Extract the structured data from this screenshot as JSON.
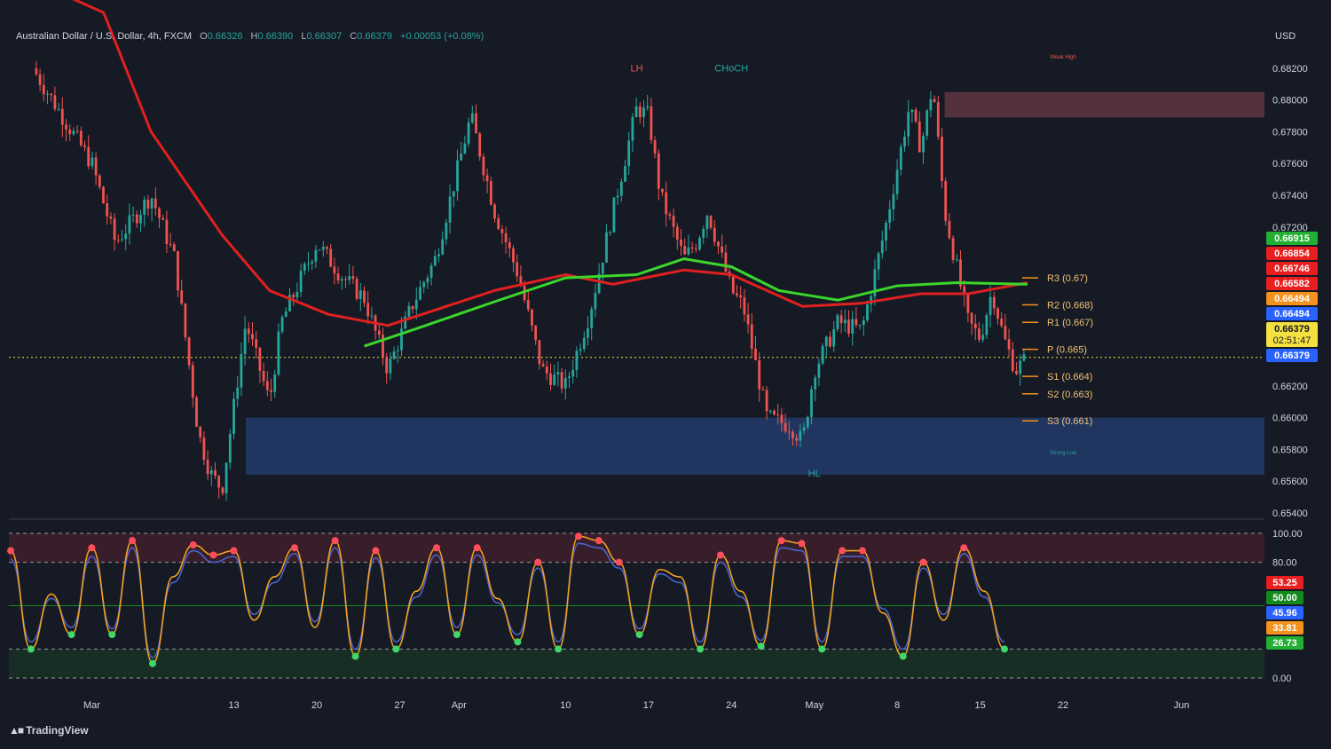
{
  "header": {
    "symbol": "Australian Dollar / U.S. Dollar, 4h, FXCM",
    "open_label": "O",
    "open": "0.66326",
    "high_label": "H",
    "high": "0.66390",
    "low_label": "L",
    "low": "0.66307",
    "close_label": "C",
    "close": "0.66379",
    "change": "+0.00053 (+0.08%)"
  },
  "currency": "USD",
  "brand": "TradingView",
  "colors": {
    "background": "#161a25",
    "bull": "#26a69a",
    "bear": "#ef5350",
    "ma_red": "#e0201f",
    "ma_green": "#3bd62a",
    "demand_zone": "#2a4d8f",
    "supply_zone": "#6b3a45",
    "stoch_k": "#4a62c9",
    "stoch_d": "#f0a01e"
  },
  "chart_data": [
    {
      "type": "candlestick",
      "title": "Australian Dollar / U.S. Dollar, 4h, FXCM",
      "ylim": [
        0.654,
        0.6835
      ],
      "y_ticks": [
        "0.68200",
        "0.68000",
        "0.67800",
        "0.67600",
        "0.67400",
        "0.67200",
        "0.66200",
        "0.66000",
        "0.65800",
        "0.65600",
        "0.65400"
      ],
      "x_ticks": [
        "Mar",
        "13",
        "20",
        "27",
        "Apr",
        "10",
        "17",
        "24",
        "May",
        "8",
        "15",
        "22",
        "Jun"
      ],
      "price_path": [
        {
          "date": "Feb 24",
          "price": 0.682
        },
        {
          "date": "Mar 1",
          "price": 0.676
        },
        {
          "date": "Mar 3",
          "price": 0.671
        },
        {
          "date": "Mar 6",
          "price": 0.674
        },
        {
          "date": "Mar 8",
          "price": 0.67
        },
        {
          "date": "Mar 10",
          "price": 0.659
        },
        {
          "date": "Mar 11",
          "price": 0.6565
        },
        {
          "date": "Mar 12",
          "price": 0.6555
        },
        {
          "date": "Mar 14",
          "price": 0.666
        },
        {
          "date": "Mar 16",
          "price": 0.661
        },
        {
          "date": "Mar 17",
          "price": 0.666
        },
        {
          "date": "Mar 20",
          "price": 0.671
        },
        {
          "date": "Mar 22",
          "price": 0.669
        },
        {
          "date": "Mar 24",
          "price": 0.6675
        },
        {
          "date": "Mar 26",
          "price": 0.663
        },
        {
          "date": "Mar 28",
          "price": 0.667
        },
        {
          "date": "Mar 30",
          "price": 0.67
        },
        {
          "date": "Apr 2",
          "price": 0.679
        },
        {
          "date": "Apr 4",
          "price": 0.673
        },
        {
          "date": "Apr 6",
          "price": 0.669
        },
        {
          "date": "Apr 8",
          "price": 0.663
        },
        {
          "date": "Apr 10",
          "price": 0.662
        },
        {
          "date": "Apr 12",
          "price": 0.6665
        },
        {
          "date": "Apr 14",
          "price": 0.673
        },
        {
          "date": "Apr 16",
          "price": 0.6795
        },
        {
          "date": "Apr 17",
          "price": 0.679
        },
        {
          "date": "Apr 18",
          "price": 0.674
        },
        {
          "date": "Apr 20",
          "price": 0.67
        },
        {
          "date": "Apr 21",
          "price": 0.671
        },
        {
          "date": "Apr 22",
          "price": 0.673
        },
        {
          "date": "Apr 24",
          "price": 0.668
        },
        {
          "date": "Apr 25",
          "price": 0.667
        },
        {
          "date": "Apr 27",
          "price": 0.66
        },
        {
          "date": "Apr 29",
          "price": 0.6595
        },
        {
          "date": "Apr 30",
          "price": 0.6585
        },
        {
          "date": "May 1",
          "price": 0.663
        },
        {
          "date": "May 3",
          "price": 0.666
        },
        {
          "date": "May 5",
          "price": 0.6655
        },
        {
          "date": "May 7",
          "price": 0.672
        },
        {
          "date": "May 9",
          "price": 0.6795
        },
        {
          "date": "May 10",
          "price": 0.677
        },
        {
          "date": "May 11",
          "price": 0.681
        },
        {
          "date": "May 12",
          "price": 0.673
        },
        {
          "date": "May 14",
          "price": 0.666
        },
        {
          "date": "May 15",
          "price": 0.665
        },
        {
          "date": "May 16",
          "price": 0.668
        },
        {
          "date": "May 17",
          "price": 0.665
        },
        {
          "date": "May 18",
          "price": 0.663
        },
        {
          "date": "May 19",
          "price": 0.66379
        }
      ],
      "ma_slow": [
        {
          "date": "Feb 24",
          "price": 0.6875
        },
        {
          "date": "Mar 2",
          "price": 0.6855
        },
        {
          "date": "Mar 6",
          "price": 0.678
        },
        {
          "date": "Mar 12",
          "price": 0.6715
        },
        {
          "date": "Mar 16",
          "price": 0.668
        },
        {
          "date": "Mar 21",
          "price": 0.6665
        },
        {
          "date": "Mar 26",
          "price": 0.6658
        },
        {
          "date": "Apr 4",
          "price": 0.668
        },
        {
          "date": "Apr 10",
          "price": 0.669
        },
        {
          "date": "Apr 14",
          "price": 0.6684
        },
        {
          "date": "Apr 20",
          "price": 0.6693
        },
        {
          "date": "Apr 24",
          "price": 0.669
        },
        {
          "date": "Apr 30",
          "price": 0.667
        },
        {
          "date": "May 5",
          "price": 0.6672
        },
        {
          "date": "May 10",
          "price": 0.6678
        },
        {
          "date": "May 14",
          "price": 0.6678
        },
        {
          "date": "May 19",
          "price": 0.6685
        }
      ],
      "ma_green": [
        {
          "date": "Mar 24",
          "price": 0.6645
        },
        {
          "date": "Mar 28",
          "price": 0.6655
        },
        {
          "date": "Apr 4",
          "price": 0.6673
        },
        {
          "date": "Apr 10",
          "price": 0.6688
        },
        {
          "date": "Apr 16",
          "price": 0.669
        },
        {
          "date": "Apr 20",
          "price": 0.67
        },
        {
          "date": "Apr 24",
          "price": 0.6695
        },
        {
          "date": "Apr 28",
          "price": 0.668
        },
        {
          "date": "May 3",
          "price": 0.6674
        },
        {
          "date": "May 8",
          "price": 0.6683
        },
        {
          "date": "May 13",
          "price": 0.6685
        },
        {
          "date": "May 19",
          "price": 0.6684
        }
      ],
      "levels": [
        {
          "label": "R3 (0.67)",
          "price": 0.6688
        },
        {
          "label": "R2 (0.668)",
          "price": 0.6671
        },
        {
          "label": "R1 (0.667)",
          "price": 0.666
        },
        {
          "label": "P (0.665)",
          "price": 0.6643
        },
        {
          "label": "S1 (0.664)",
          "price": 0.6626
        },
        {
          "label": "S2 (0.663)",
          "price": 0.6615
        },
        {
          "label": "S3 (0.661)",
          "price": 0.6598
        }
      ],
      "zones": [
        {
          "type": "supply",
          "from": "May 12",
          "to": "Jun 8",
          "top": 0.6805,
          "bottom": 0.6789
        },
        {
          "type": "demand",
          "from": "Mar 14",
          "to": "Jun 8",
          "top": 0.66,
          "bottom": 0.6564
        }
      ],
      "annotations": [
        {
          "text": "LH",
          "date": "Apr 16",
          "price": 0.6818
        },
        {
          "text": "CHoCH",
          "date": "Apr 24",
          "price": 0.6818
        },
        {
          "text": "HL",
          "date": "May 1",
          "price": 0.6563
        },
        {
          "text": "Weak High",
          "date": "May 22",
          "price": 0.6826
        },
        {
          "text": "Strong Low",
          "date": "May 22",
          "price": 0.6577
        }
      ],
      "price_labels": [
        {
          "value": "0.66915",
          "color": "#22b033"
        },
        {
          "value": "0.66854",
          "color": "#e91e1e"
        },
        {
          "value": "0.66746",
          "color": "#e91e1e"
        },
        {
          "value": "0.66582",
          "color": "#e91e1e"
        },
        {
          "value": "0.66494",
          "color": "#f5921e"
        },
        {
          "value": "0.66494",
          "color": "#2962ff"
        },
        {
          "value": "0.66379",
          "color": "#f5e042"
        },
        {
          "value": "0.66379",
          "color": "#2962ff"
        }
      ],
      "countdown": "02:51:47"
    },
    {
      "type": "line",
      "title": "",
      "ylim": [
        0,
        100
      ],
      "y_ticks": [
        "100.00",
        "80.00",
        "0.00"
      ],
      "series": [
        {
          "values": [
            88,
            20,
            58,
            30,
            90,
            30,
            95,
            10,
            70,
            92,
            85,
            88,
            40,
            70,
            90,
            35,
            95,
            15,
            88,
            20,
            60,
            90,
            30,
            90,
            55,
            25,
            80,
            20,
            98,
            95,
            80,
            30,
            75,
            70,
            20,
            85,
            60,
            22,
            95,
            93,
            20,
            88,
            88,
            45,
            15,
            80,
            40,
            90,
            60,
            20
          ]
        },
        {
          "values": [
            82,
            25,
            55,
            35,
            84,
            34,
            90,
            14,
            66,
            88,
            80,
            84,
            44,
            66,
            86,
            39,
            90,
            20,
            83,
            25,
            56,
            85,
            35,
            85,
            52,
            30,
            76,
            25,
            93,
            90,
            76,
            34,
            72,
            66,
            25,
            80,
            56,
            26,
            90,
            88,
            25,
            84,
            84,
            48,
            20,
            76,
            44,
            86,
            56,
            25
          ]
        }
      ],
      "value_labels": [
        {
          "value": "53.25",
          "color": "#e91e1e"
        },
        {
          "value": "50.00",
          "color": "#148a1c"
        },
        {
          "value": "45.96",
          "color": "#2962ff"
        },
        {
          "value": "33.81",
          "color": "#f5921e"
        },
        {
          "value": "26.73",
          "color": "#22b033"
        }
      ]
    }
  ]
}
